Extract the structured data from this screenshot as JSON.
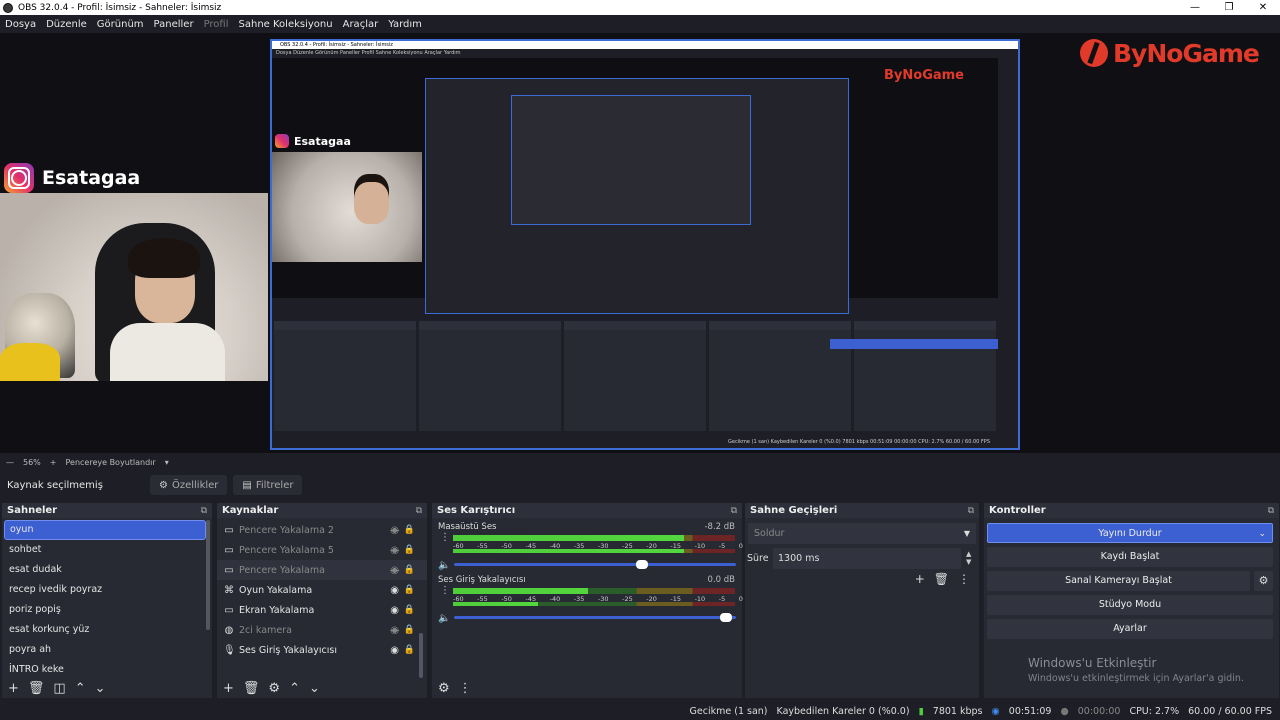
{
  "window": {
    "title": "OBS 32.0.4 - Profil: İsimsiz - Sahneler: İsimsiz"
  },
  "menu": [
    "Dosya",
    "Düzenle",
    "Görünüm",
    "Paneller",
    "Profil",
    "Sahne Koleksiyonu",
    "Araçlar",
    "Yardım"
  ],
  "overlay": {
    "instagram_name": "Esatagaa",
    "brand": "ByNoGame"
  },
  "nested": {
    "title": "OBS 32.0.4 - Profil: İsimsiz - Sahneler: İsimsiz",
    "menu": "Dosya  Düzenle  Görünüm  Paneller  Profil  Sahne Koleksiyonu  Araçlar  Yardım",
    "status": "Gecikme (1 san)   Kaybedilen Kareler 0 (%0.0)   7801 kbps   00:51:09   00:00:00   CPU: 2.7%   60.00 / 60.00 FPS"
  },
  "zoom": {
    "value": "56%",
    "fit_label": "Pencereye Boyutlandır"
  },
  "source_bar": {
    "label": "Kaynak seçilmemiş",
    "properties": "Özellikler",
    "filters": "Filtreler"
  },
  "scenes": {
    "title": "Sahneler",
    "items": [
      "oyun",
      "sohbet",
      "esat dudak",
      "recep ivedik poyraz",
      "poriz popiş",
      "esat korkunç yüz",
      "poyra ah",
      "İNTRO keke"
    ],
    "active_index": 0
  },
  "sources": {
    "title": "Kaynaklar",
    "items": [
      {
        "name": "Pencere Yakalama 2",
        "icon": "window-icon",
        "visible": false
      },
      {
        "name": "Pencere Yakalama 5",
        "icon": "window-icon",
        "visible": false
      },
      {
        "name": "Pencere Yakalama",
        "icon": "window-icon",
        "visible": false
      },
      {
        "name": "Oyun Yakalama",
        "icon": "gamepad-icon",
        "visible": true
      },
      {
        "name": "Ekran Yakalama",
        "icon": "monitor-icon",
        "visible": true
      },
      {
        "name": "2ci kamera",
        "icon": "camera-icon",
        "visible": false
      },
      {
        "name": "Ses Giriş Yakalayıcısı",
        "icon": "microphone-icon",
        "visible": true
      }
    ]
  },
  "mixer": {
    "title": "Ses Karıştırıcı",
    "ticks": [
      "-60",
      "-55",
      "-50",
      "-45",
      "-40",
      "-35",
      "-30",
      "-25",
      "-20",
      "-15",
      "-10",
      "-5",
      "0"
    ],
    "channels": [
      {
        "name": "Masaüstü Ses",
        "db": "-8.2 dB",
        "level_top": 0.82,
        "level_bottom": 0.82,
        "volume": 0.68
      },
      {
        "name": "Ses Giriş Yakalayıcısı",
        "db": "0.0 dB",
        "level_top": 0.48,
        "level_bottom": 0.3,
        "volume": 0.98
      }
    ]
  },
  "transitions": {
    "title": "Sahne Geçişleri",
    "selected": "Soldur",
    "duration_label": "Süre",
    "duration": "1300 ms"
  },
  "controls": {
    "title": "Kontroller",
    "buttons": [
      "Yayını Durdur",
      "Kaydı Başlat",
      "Sanal Kamerayı Başlat",
      "Stüdyo Modu",
      "Ayarlar"
    ]
  },
  "watermark": {
    "line1": "Windows'u Etkinleştir",
    "line2": "Windows'u etkinleştirmek için Ayarlar'a gidin."
  },
  "status": {
    "delay": "Gecikme (1 san)",
    "dropped": "Kaybedilen Kareler 0 (%0.0)",
    "bitrate": "7801 kbps",
    "stream_time": "00:51:09",
    "rec_time": "00:00:00",
    "cpu": "CPU: 2.7%",
    "fps": "60.00 / 60.00 FPS"
  },
  "colors": {
    "accent": "#3c5fd1",
    "panel": "#272a33",
    "bg": "#1e1f26",
    "meter_green": "#4fcc3a",
    "brand_red": "#e23a2a"
  }
}
